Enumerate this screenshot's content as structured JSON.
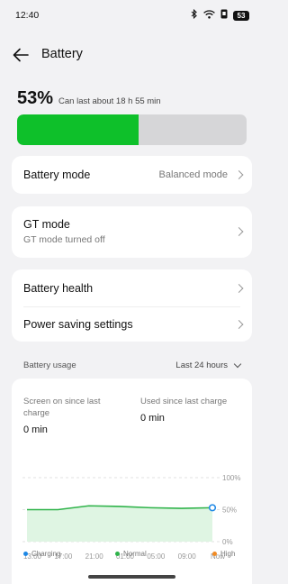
{
  "status": {
    "time": "12:40",
    "battery": "53"
  },
  "appbar": {
    "title": "Battery"
  },
  "summary": {
    "percent": "53%",
    "estimate": "Can last about 18 h 55 min",
    "level": 0.53
  },
  "battery_mode": {
    "label": "Battery mode",
    "value": "Balanced mode"
  },
  "gt_mode": {
    "label": "GT mode",
    "subtitle": "GT mode turned off"
  },
  "settings": {
    "health": "Battery health",
    "power_saving": "Power saving settings"
  },
  "usage": {
    "title": "Battery usage",
    "range": "Last 24 hours",
    "screen_on_label": "Screen on since last charge",
    "screen_on_value": "0 min",
    "used_label": "Used since last charge",
    "used_value": "0 min"
  },
  "chart_data": {
    "type": "line",
    "x": [
      "13:00",
      "17:00",
      "21:00",
      "01:00",
      "05:00",
      "09:00",
      "Now"
    ],
    "series": [
      {
        "name": "",
        "values": [
          50,
          50,
          56,
          55,
          53,
          52,
          53
        ]
      }
    ],
    "yticks": [
      "100%",
      "50%",
      "0%"
    ],
    "ylim": [
      0,
      100
    ],
    "legend": [
      "Charging",
      "Normal",
      "High"
    ],
    "colors": {
      "charging": "#1e88e5",
      "normal": "#2fb34a",
      "high": "#f08a24"
    }
  }
}
